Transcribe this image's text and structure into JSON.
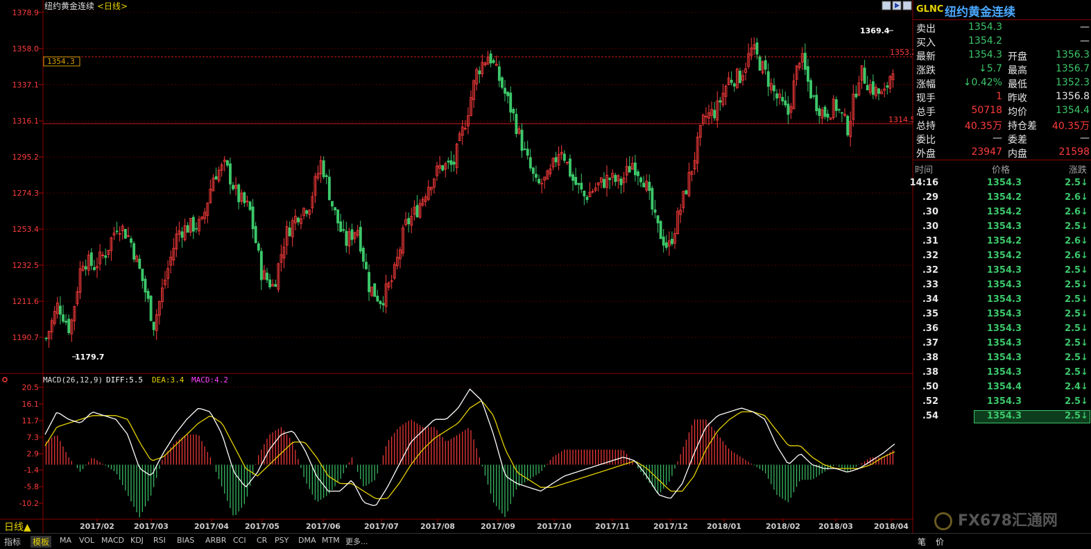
{
  "chart_header": {
    "title": "纽约黄金连续",
    "period": "<日线>"
  },
  "price_labels": {
    "current": "1354.3",
    "high_marker": "1369.4",
    "low_marker": "1179.7",
    "ref_line_high": "1353.2",
    "ref_line_low": "1314.5"
  },
  "macd_header": {
    "params": "MACD(26,12,9)",
    "diff": "DIFF:5.5",
    "dea": "DEA:3.4",
    "macd": "MACD:4.2"
  },
  "period_button": "日线▲",
  "colors": {
    "up": "#ff3c3c",
    "down": "#3cc76a",
    "diff_line": "#ffffff",
    "dea_line": "#e6d200",
    "macd_label": "#ff40ff",
    "grid": "#8b0000"
  },
  "bottom_tabs": [
    "指标",
    "模板",
    "MA",
    "VOL",
    "MACD",
    "KDJ",
    "RSI",
    "BIAS",
    "ARBR",
    "CCI",
    "CR",
    "PSY",
    "DMA",
    "MTM",
    "更多..."
  ],
  "quote_panel": {
    "code": "GLNC",
    "name": "纽约黄金连续",
    "rows": [
      {
        "l1": "卖出",
        "v1": "1354.3",
        "l2": "",
        "v2": "—"
      },
      {
        "l1": "买入",
        "v1": "1354.2",
        "l2": "",
        "v2": "—"
      },
      {
        "l1": "最新",
        "v1": "1354.3",
        "l2": "开盘",
        "v2": "1356.3"
      },
      {
        "l1": "涨跌",
        "v1": "↓5.7",
        "l2": "最高",
        "v2": "1356.7"
      },
      {
        "l1": "涨幅",
        "v1": "↓0.42%",
        "l2": "最低",
        "v2": "1352.3"
      },
      {
        "l1": "现手",
        "v1": "1",
        "l2": "昨收",
        "v2": "1356.8"
      },
      {
        "l1": "总手",
        "v1": "50718",
        "l2": "均价",
        "v2": "1354.4"
      },
      {
        "l1": "总持",
        "v1": "40.35万",
        "l2": "持仓差",
        "v2": "40.35万"
      },
      {
        "l1": "委比",
        "v1": "—",
        "l2": "委差",
        "v2": "—"
      },
      {
        "l1": "外盘",
        "v1": "23947",
        "l2": "内盘",
        "v2": "21598"
      }
    ],
    "tick_headers": [
      "时间",
      "价格",
      "涨跌"
    ],
    "ticks": [
      {
        "t": "14:16",
        "p": "1354.3",
        "c": "2.5↓"
      },
      {
        "t": ".29",
        "p": "1354.2",
        "c": "2.6↓"
      },
      {
        "t": ".30",
        "p": "1354.2",
        "c": "2.6↓"
      },
      {
        "t": ".30",
        "p": "1354.3",
        "c": "2.5↓"
      },
      {
        "t": ".31",
        "p": "1354.2",
        "c": "2.6↓"
      },
      {
        "t": ".32",
        "p": "1354.2",
        "c": "2.6↓"
      },
      {
        "t": ".32",
        "p": "1354.3",
        "c": "2.5↓"
      },
      {
        "t": ".33",
        "p": "1354.3",
        "c": "2.5↓"
      },
      {
        "t": ".34",
        "p": "1354.3",
        "c": "2.5↓"
      },
      {
        "t": ".35",
        "p": "1354.3",
        "c": "2.5↓"
      },
      {
        "t": ".36",
        "p": "1354.3",
        "c": "2.5↓"
      },
      {
        "t": ".37",
        "p": "1354.3",
        "c": "2.5↓"
      },
      {
        "t": ".38",
        "p": "1354.3",
        "c": "2.5↓"
      },
      {
        "t": ".38",
        "p": "1354.3",
        "c": "2.5↓"
      },
      {
        "t": ".50",
        "p": "1354.4",
        "c": "2.4↓"
      },
      {
        "t": ".52",
        "p": "1354.3",
        "c": "2.5↓"
      },
      {
        "t": ".54",
        "p": "1354.3",
        "c": "2.5↓"
      }
    ],
    "bottom_labels": [
      "笔",
      "价"
    ],
    "watermark": "FX678汇通网"
  },
  "chart_data": [
    {
      "type": "candlestick",
      "title": "纽约黄金连续<日线>",
      "y_ticks": [
        "1378.9",
        "1358.0",
        "1337.1",
        "1316.1",
        "1295.2",
        "1274.3",
        "1253.4",
        "1232.5",
        "1211.6",
        "1190.7"
      ],
      "ylim": [
        1175,
        1382
      ],
      "x_ticks": [
        "2017/02",
        "2017/03",
        "2017/04",
        "2017/05",
        "2017/06",
        "2017/07",
        "2017/08",
        "2017/09",
        "2017/10",
        "2017/11",
        "2017/12",
        "2018/01",
        "2018/02",
        "2018/03",
        "2018/04"
      ],
      "reference_lines": [
        1353.2,
        1314.5
      ],
      "annotations": {
        "high": 1369.4,
        "low": 1179.7
      },
      "close_path": [
        [
          "2017/01",
          1190
        ],
        [
          "2017/01",
          1210
        ],
        [
          "2017/01",
          1195
        ],
        [
          "2017/02",
          1236
        ],
        [
          "2017/02",
          1232
        ],
        [
          "2017/02",
          1240
        ],
        [
          "2017/02",
          1257
        ],
        [
          "2017/02",
          1248
        ],
        [
          "2017/03",
          1225
        ],
        [
          "2017/03",
          1198
        ],
        [
          "2017/03",
          1226
        ],
        [
          "2017/03",
          1252
        ],
        [
          "2017/03",
          1255
        ],
        [
          "2017/04",
          1256
        ],
        [
          "2017/04",
          1285
        ],
        [
          "2017/04",
          1290
        ],
        [
          "2017/04",
          1272
        ],
        [
          "2017/04",
          1265
        ],
        [
          "2017/05",
          1228
        ],
        [
          "2017/05",
          1220
        ],
        [
          "2017/05",
          1250
        ],
        [
          "2017/05",
          1262
        ],
        [
          "2017/06",
          1268
        ],
        [
          "2017/06",
          1293
        ],
        [
          "2017/06",
          1265
        ],
        [
          "2017/06",
          1245
        ],
        [
          "2017/06",
          1255
        ],
        [
          "2017/07",
          1220
        ],
        [
          "2017/07",
          1212
        ],
        [
          "2017/07",
          1225
        ],
        [
          "2017/07",
          1255
        ],
        [
          "2017/08",
          1265
        ],
        [
          "2017/08",
          1280
        ],
        [
          "2017/08",
          1290
        ],
        [
          "2017/08",
          1290
        ],
        [
          "2017/08",
          1315
        ],
        [
          "2017/09",
          1345
        ],
        [
          "2017/09",
          1355
        ],
        [
          "2017/09",
          1338
        ],
        [
          "2017/09",
          1320
        ],
        [
          "2017/10",
          1297
        ],
        [
          "2017/10",
          1278
        ],
        [
          "2017/10",
          1283
        ],
        [
          "2017/10",
          1302
        ],
        [
          "2017/10",
          1282
        ],
        [
          "2017/11",
          1272
        ],
        [
          "2017/11",
          1278
        ],
        [
          "2017/11",
          1283
        ],
        [
          "2017/11",
          1280
        ],
        [
          "2017/11",
          1292
        ],
        [
          "2017/12",
          1282
        ],
        [
          "2017/12",
          1255
        ],
        [
          "2017/12",
          1242
        ],
        [
          "2017/12",
          1265
        ],
        [
          "2017/12",
          1290
        ],
        [
          "2018/01",
          1318
        ],
        [
          "2018/01",
          1322
        ],
        [
          "2018/01",
          1340
        ],
        [
          "2018/01",
          1342
        ],
        [
          "2018/01",
          1358
        ],
        [
          "2018/02",
          1345
        ],
        [
          "2018/02",
          1330
        ],
        [
          "2018/02",
          1320
        ],
        [
          "2018/02",
          1355
        ],
        [
          "2018/02",
          1330
        ],
        [
          "2018/03",
          1320
        ],
        [
          "2018/03",
          1325
        ],
        [
          "2018/03",
          1312
        ],
        [
          "2018/03",
          1345
        ],
        [
          "2018/03",
          1335
        ],
        [
          "2018/04",
          1330
        ],
        [
          "2018/04",
          1354
        ]
      ]
    },
    {
      "type": "macd",
      "title": "MACD(26,12,9)",
      "y_ticks": [
        "20.5",
        "16.1",
        "11.7",
        "7.3",
        "2.9",
        "-1.4",
        "-5.8",
        "-10.2"
      ],
      "ylim": [
        -14,
        21
      ],
      "series": [
        {
          "name": "DIFF",
          "last": 5.5
        },
        {
          "name": "DEA",
          "last": 3.4
        },
        {
          "name": "MACD",
          "last": 4.2
        }
      ],
      "diff_path": [
        8,
        14,
        12,
        11,
        14,
        13,
        12,
        8,
        -1,
        -3,
        3,
        8,
        12,
        15,
        14,
        8,
        -2,
        -6,
        -2,
        4,
        8,
        9,
        4,
        -3,
        -7,
        -7,
        -4,
        -10,
        -11,
        -6,
        0,
        6,
        9,
        12,
        12,
        15,
        20,
        17,
        8,
        -3,
        -5,
        -6,
        -7,
        -5,
        -3,
        -2,
        -1,
        0,
        1,
        2,
        1,
        -3,
        -8,
        -9,
        -5,
        3,
        10,
        13,
        14,
        15,
        14,
        12,
        5,
        0,
        3,
        0,
        -1,
        -1,
        -2,
        -1,
        1,
        3,
        5.5
      ],
      "dea_path": [
        5,
        10,
        11,
        12,
        13,
        13,
        13,
        12,
        6,
        1,
        2,
        5,
        8,
        11,
        13,
        11,
        5,
        -1,
        -3,
        0,
        3,
        6,
        6,
        2,
        -3,
        -5,
        -5,
        -7,
        -9,
        -9,
        -5,
        0,
        4,
        7,
        9,
        11,
        15,
        17,
        13,
        4,
        -2,
        -4,
        -6,
        -6,
        -5,
        -4,
        -3,
        -2,
        -1,
        0,
        1,
        -1,
        -4,
        -7,
        -7,
        -3,
        4,
        9,
        12,
        14,
        14,
        13,
        9,
        5,
        5,
        2,
        0,
        -1,
        -1,
        -1,
        0,
        2,
        3.4
      ]
    }
  ]
}
